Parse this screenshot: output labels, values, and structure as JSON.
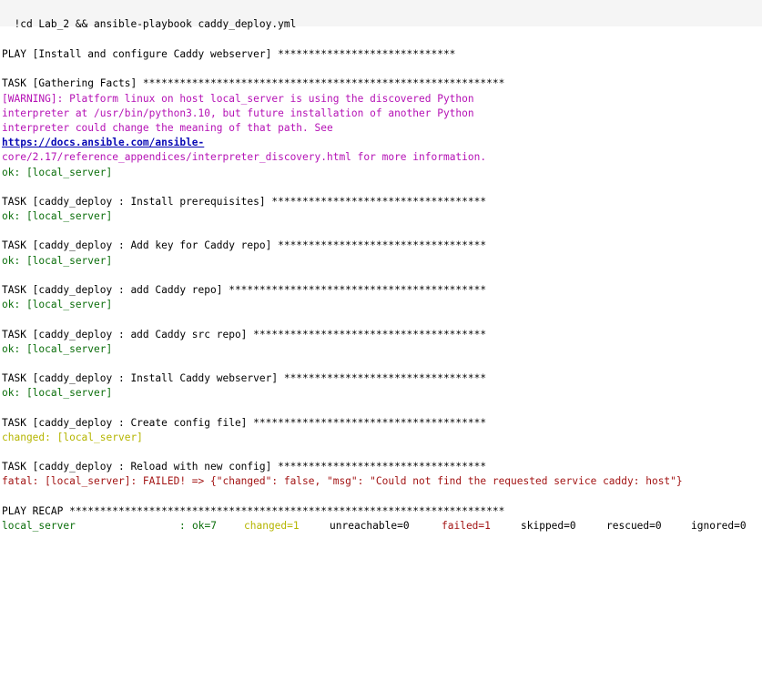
{
  "cell": {
    "command": "!cd Lab_2 && ansible-playbook caddy_deploy.yml"
  },
  "colors": {
    "ok": "#0b6e0b",
    "changed": "#b5b500",
    "fatal": "#a31515",
    "warning": "#b512b5",
    "link": "#0a0ab5"
  },
  "output": {
    "play_header": "PLAY [Install and configure Caddy webserver] *****************************",
    "gather_header": "TASK [Gathering Facts] ***********************************************************",
    "warning_1": "[WARNING]: Platform linux on host local_server is using the discovered Python",
    "warning_2": "interpreter at /usr/bin/python3.10, but future installation of another Python",
    "warning_3": "interpreter could change the meaning of that path. See",
    "warning_link": "https://docs.ansible.com/ansible-",
    "warning_link_cont": "core/2.17/reference_appendices/interpreter_discovery.html",
    "warning_tail": " for more information.",
    "gather_result": "ok: [local_server]",
    "tasks": [
      {
        "header": "TASK [caddy_deploy : Install prerequisites] ***********************************",
        "result": "ok: [local_server]"
      },
      {
        "header": "TASK [caddy_deploy : Add key for Caddy repo] **********************************",
        "result": "ok: [local_server]"
      },
      {
        "header": "TASK [caddy_deploy : add Caddy repo] ******************************************",
        "result": "ok: [local_server]"
      },
      {
        "header": "TASK [caddy_deploy : add Caddy src repo] **************************************",
        "result": "ok: [local_server]"
      },
      {
        "header": "TASK [caddy_deploy : Install Caddy webserver] *********************************",
        "result": "ok: [local_server]"
      },
      {
        "header": "TASK [caddy_deploy : Create config file] **************************************",
        "result": "changed: [local_server]"
      },
      {
        "header": "TASK [caddy_deploy : Reload with new config] **********************************",
        "result": "fatal: [local_server]: FAILED! => {\"changed\": false, \"msg\": \"Could not find the requested service caddy: host\"}"
      }
    ],
    "recap_header": "PLAY RECAP ***********************************************************************",
    "recap": {
      "host": "local_server",
      "sep": ":",
      "ok": "ok=7",
      "changed": "changed=1",
      "unreachable": "unreachable=0",
      "failed": "failed=1",
      "skipped": "skipped=0",
      "rescued": "rescued=0",
      "ignored": "ignored=0"
    }
  }
}
